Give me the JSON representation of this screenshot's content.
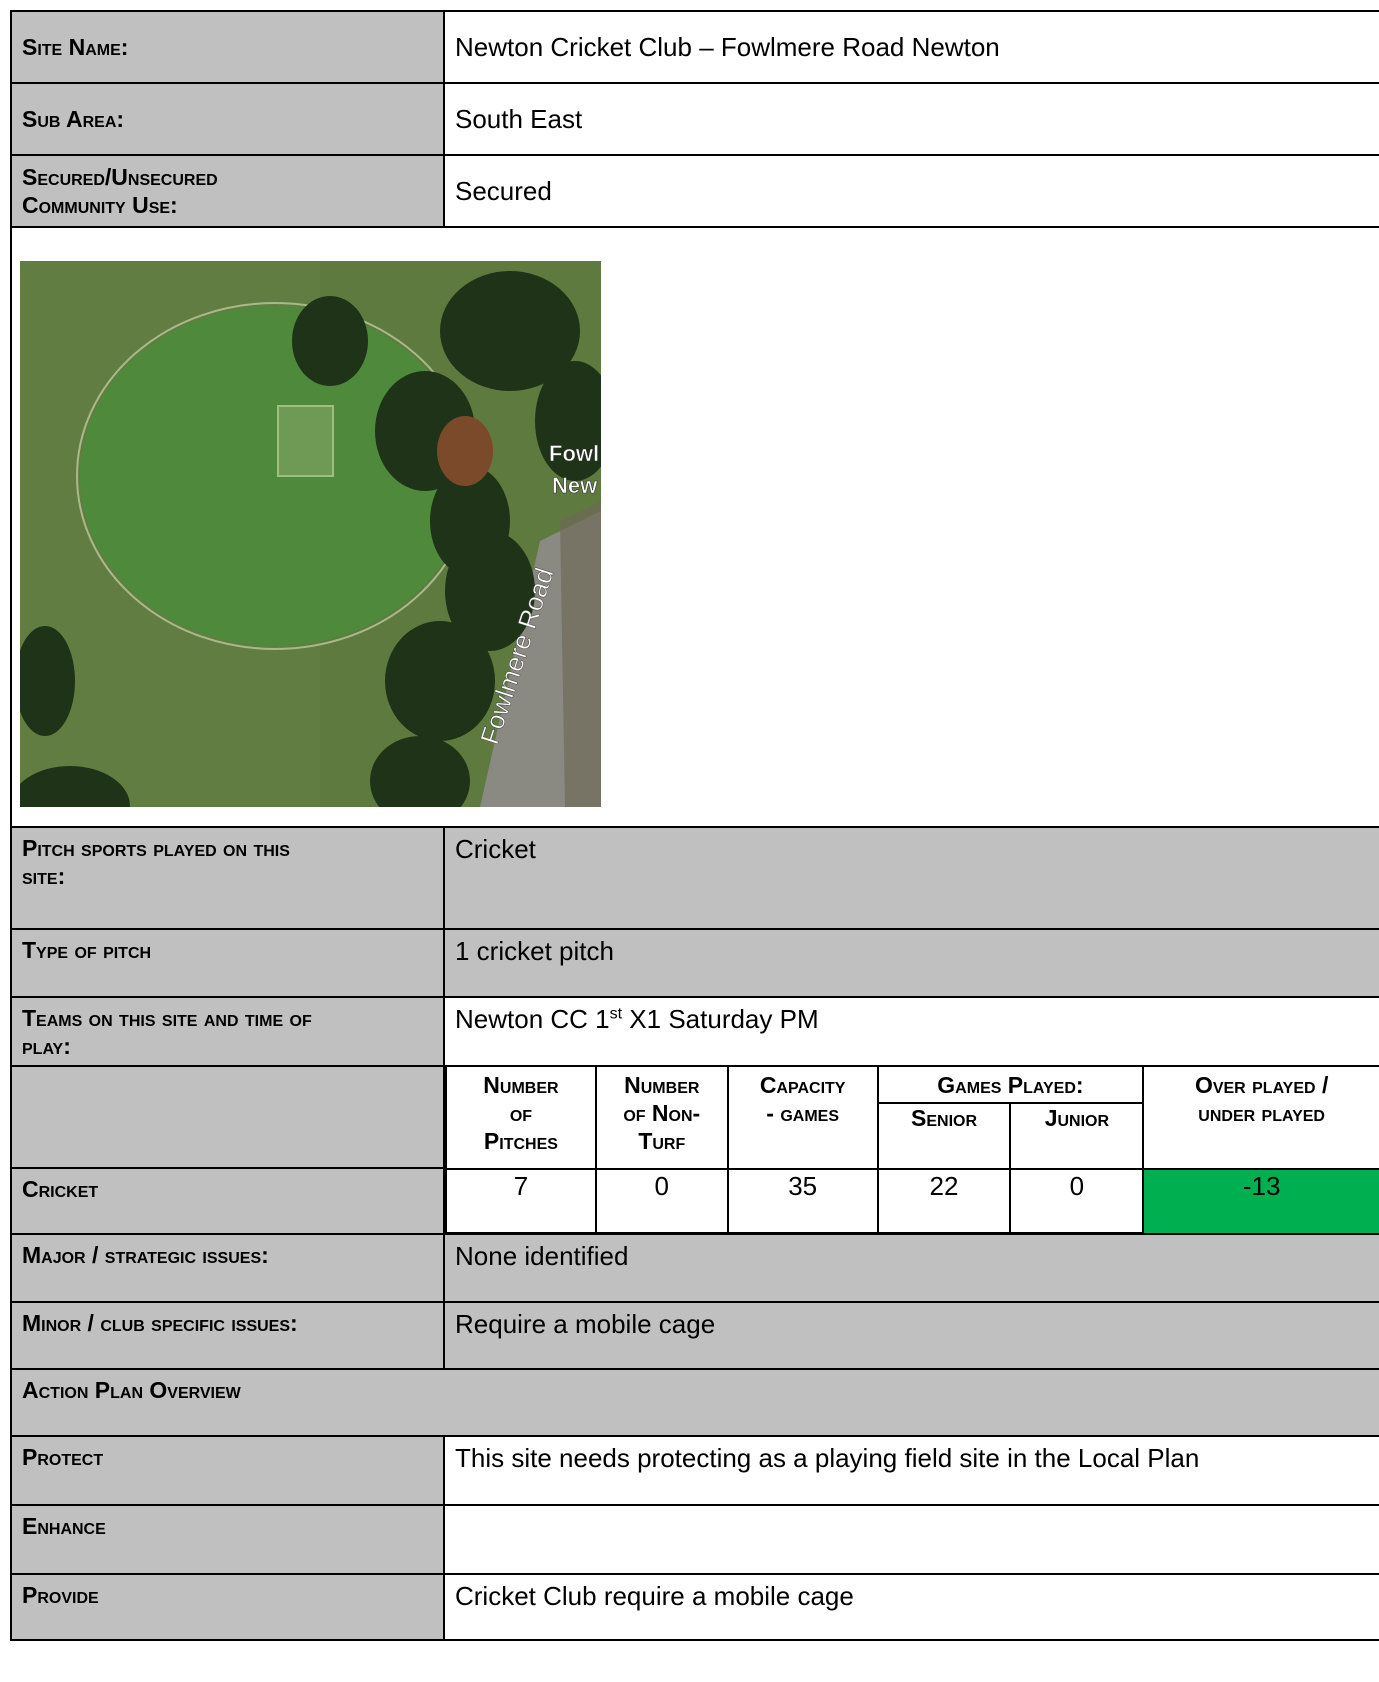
{
  "site_name": {
    "label": "Site Name:",
    "value": "Newton Cricket Club – Fowlmere Road Newton"
  },
  "sub_area": {
    "label": "Sub Area:",
    "value": "South East"
  },
  "community_use": {
    "label_line1": "Secured/Unsecured",
    "label_line2": "Community Use:",
    "value": "Secured"
  },
  "map": {
    "road_label": "Fowlmere Road",
    "place_label_line1": "Fowl",
    "place_label_line2": "New",
    "colors": {
      "grass": "#5f7a3f",
      "outfield": "#4f8a3c",
      "trees": "#1f3318",
      "road": "#8a8a82"
    }
  },
  "pitch_sports": {
    "label_line1": "Pitch sports played on this",
    "label_line2": "site:",
    "value": "Cricket"
  },
  "pitch_type": {
    "label": "Type of pitch",
    "value": "1 cricket pitch"
  },
  "teams": {
    "label_line1": "Teams on this site and time of",
    "label_line2": "play:",
    "value_prefix": "Newton CC 1",
    "value_sup": "st",
    "value_suffix": " X1 Saturday PM"
  },
  "stats": {
    "headers": {
      "pitches": [
        "Number",
        "of",
        "Pitches"
      ],
      "non_turf": [
        "Number",
        "of Non-",
        "Turf"
      ],
      "capacity": [
        "Capacity",
        "- games"
      ],
      "games_played": "Games Played:",
      "senior": "Senior",
      "junior": "Junior",
      "over_under": [
        "Over played /",
        "under played"
      ]
    },
    "row_label": "Cricket",
    "values": {
      "pitches": "7",
      "non_turf": "0",
      "capacity": "35",
      "senior": "22",
      "junior": "0",
      "over_under": "-13"
    },
    "highlight_color": "#00b050"
  },
  "major_issues": {
    "label": "Major / strategic issues:",
    "value": "None identified"
  },
  "minor_issues": {
    "label": "Minor / club specific issues:",
    "value": "Require a mobile cage"
  },
  "action_plan": {
    "label": "Action Plan Overview"
  },
  "protect": {
    "label": "Protect",
    "value": "This site needs protecting as a playing field site in the Local Plan"
  },
  "enhance": {
    "label": "Enhance",
    "value": ""
  },
  "provide": {
    "label": "Provide",
    "value": "Cricket Club require a mobile cage"
  }
}
